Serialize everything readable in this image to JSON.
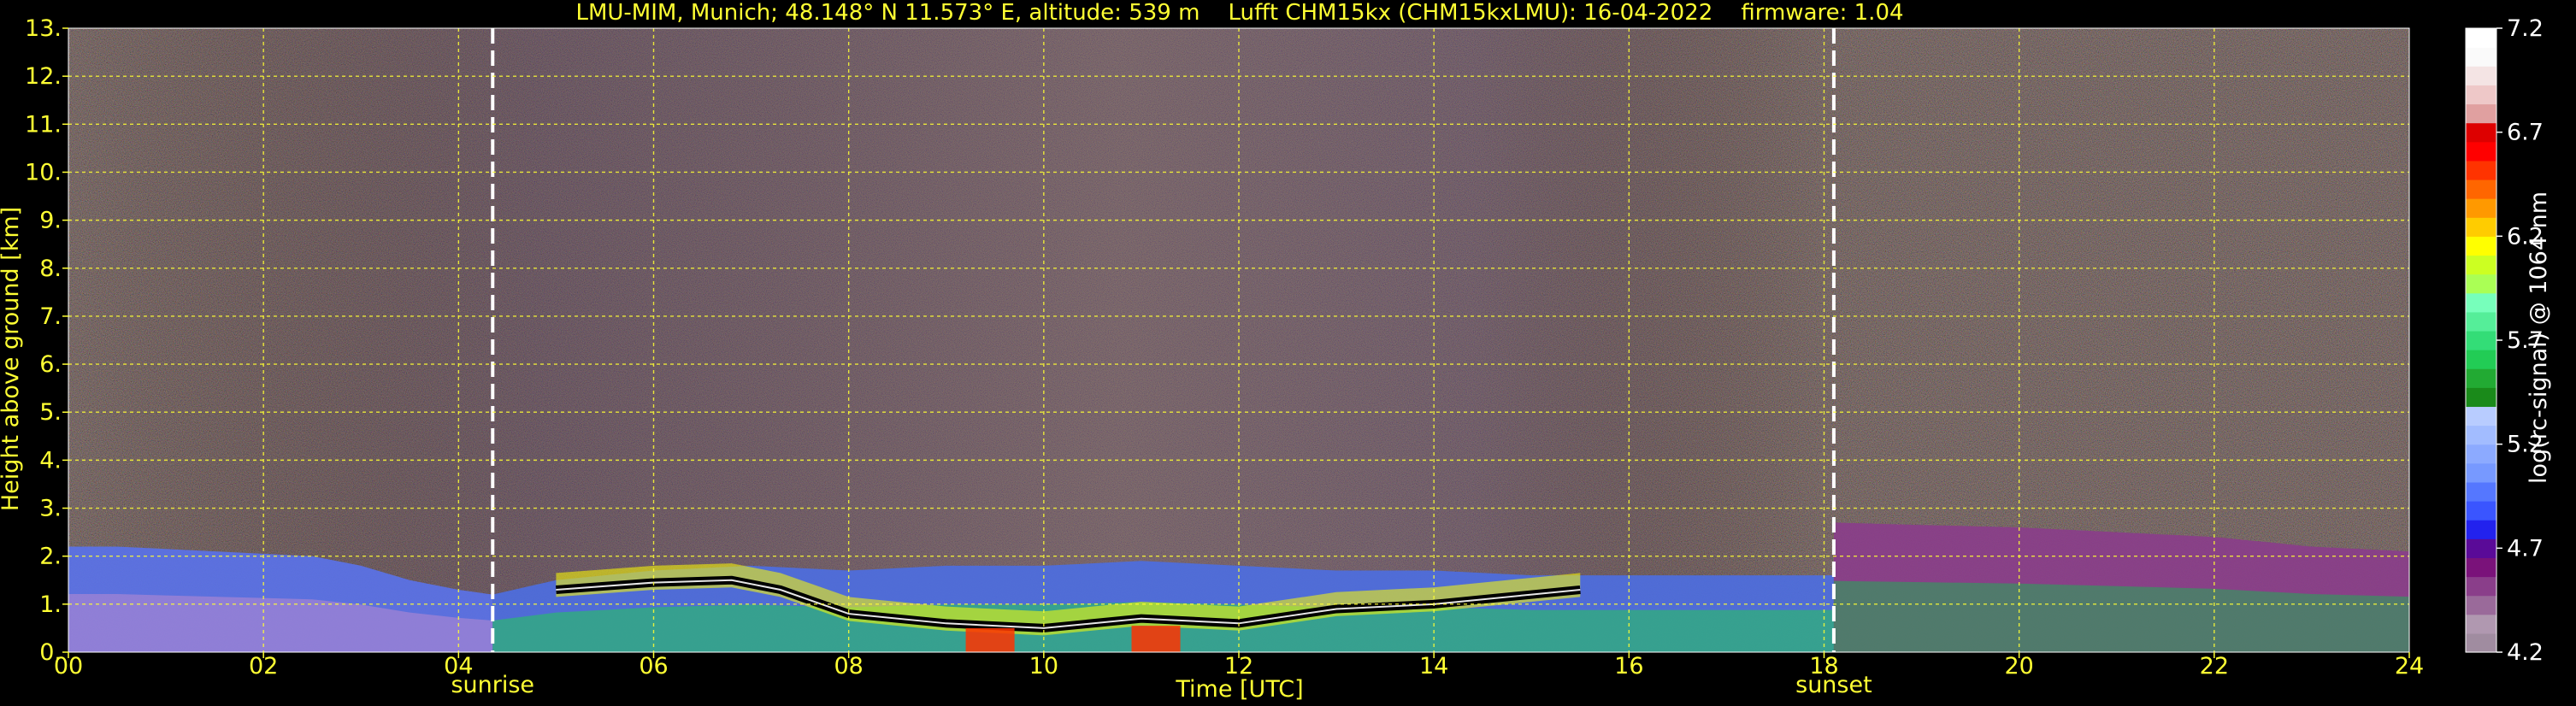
{
  "chart_data": {
    "type": "heatmap",
    "title": "LMU-MIM, Munich; 48.148° N 11.573° E, altitude: 539 m    Lufft CHM15kx (CHM15kxLMU): 16-04-2022    firmware: 1.04",
    "xlabel": "Time [UTC]",
    "ylabel": "Height above ground [km]",
    "xlim": [
      0,
      24
    ],
    "ylim": [
      0,
      13
    ],
    "x_tick_labels": [
      "00",
      "02",
      "04",
      "06",
      "08",
      "10",
      "12",
      "14",
      "16",
      "18",
      "20",
      "22",
      "24"
    ],
    "y_tick_labels": [
      "0.",
      "1.",
      "2.",
      "3.",
      "4.",
      "5.",
      "6.",
      "7.",
      "8.",
      "9.",
      "10.",
      "11.",
      "12.",
      "13."
    ],
    "grid": true,
    "colorbar": {
      "label": "log(rc-signal) @ 1064 nm",
      "range": [
        4.2,
        7.2
      ],
      "tick_labels": [
        "4.2",
        "4.7",
        "5.2",
        "5.7",
        "6.2",
        "6.7",
        "7.2"
      ],
      "colors": [
        "#a08ca0",
        "#b098b0",
        "#9a6a9a",
        "#8a3e8a",
        "#7a127a",
        "#5a0a98",
        "#2222ee",
        "#3a55ff",
        "#5577ff",
        "#7799ff",
        "#8caaff",
        "#a2bcff",
        "#b8ccff",
        "#1a8a1a",
        "#22aa33",
        "#22cc55",
        "#33dd77",
        "#55ee99",
        "#77ffbb",
        "#aaff55",
        "#ccff22",
        "#ffff00",
        "#ffcc00",
        "#ff9900",
        "#ff6600",
        "#ff3300",
        "#ff0000",
        "#dd0000",
        "#e0a0a0",
        "#eec8c8",
        "#f4e4e4",
        "#fafafa",
        "#ffffff"
      ]
    },
    "events": [
      {
        "label": "sunrise",
        "time": 4.35
      },
      {
        "label": "sunset",
        "time": 18.1
      }
    ],
    "layers": [
      {
        "kind": "aerosol",
        "x": [
          0,
          0.5,
          1,
          1.5,
          2,
          2.5,
          3,
          3.5,
          4,
          4.35
        ],
        "y_top": [
          2.2,
          2.2,
          2.15,
          2.1,
          2.05,
          2.0,
          1.8,
          1.5,
          1.3,
          1.2
        ]
      },
      {
        "kind": "aerosol",
        "x": [
          4.35,
          5,
          6,
          7,
          8,
          9,
          10,
          11,
          12,
          13,
          14,
          15,
          16,
          17,
          18.1
        ],
        "y_top": [
          1.2,
          1.5,
          1.7,
          1.8,
          1.7,
          1.8,
          1.8,
          1.9,
          1.8,
          1.7,
          1.7,
          1.6,
          1.6,
          1.6,
          1.6
        ]
      },
      {
        "kind": "aerosol",
        "x": [
          18.1,
          19,
          20,
          21,
          22,
          23,
          24
        ],
        "y_top": [
          2.7,
          2.65,
          2.6,
          2.5,
          2.4,
          2.2,
          2.1
        ]
      },
      {
        "kind": "cloud_base",
        "x": [
          5,
          6,
          6.8,
          7.3,
          8,
          9,
          10,
          11,
          12,
          13,
          14,
          15,
          15.5
        ],
        "y": [
          1.3,
          1.45,
          1.5,
          1.3,
          0.8,
          0.6,
          0.5,
          0.7,
          0.6,
          0.9,
          1.0,
          1.2,
          1.3
        ]
      },
      {
        "kind": "precipitation",
        "x": [
          9.2,
          9.7,
          10.9,
          11.4
        ],
        "y": [
          0.3,
          0.3,
          0.35,
          0.35
        ]
      }
    ]
  }
}
